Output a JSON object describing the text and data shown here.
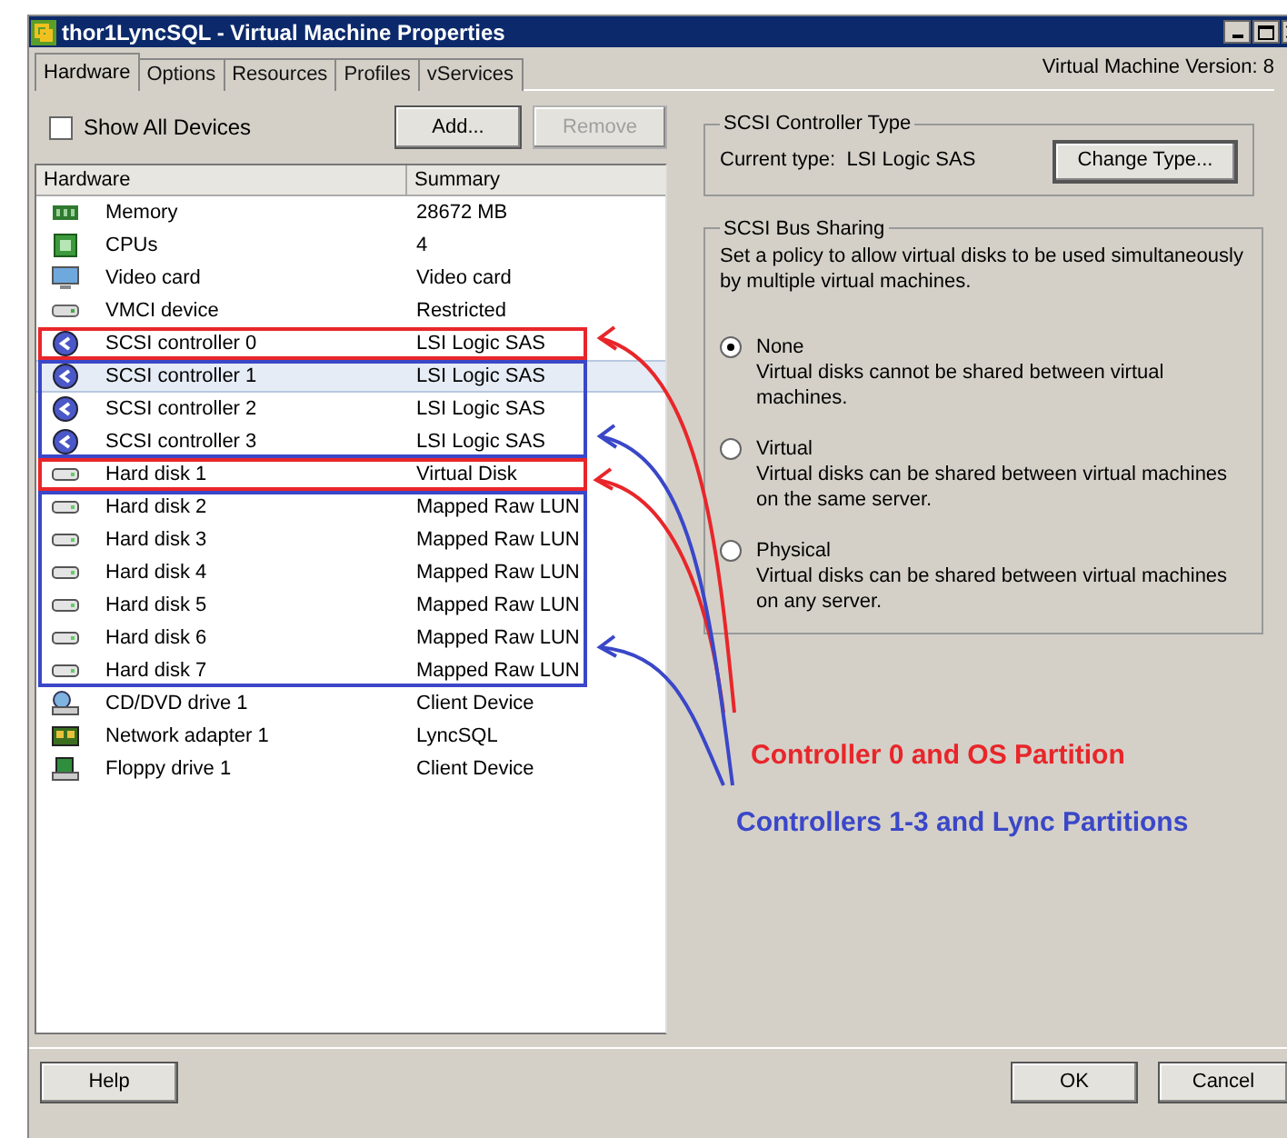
{
  "window": {
    "title": "thor1LyncSQL - Virtual Machine Properties"
  },
  "tabs": [
    {
      "label": "Hardware",
      "selected": true
    },
    {
      "label": "Options",
      "selected": false
    },
    {
      "label": "Resources",
      "selected": false
    },
    {
      "label": "Profiles",
      "selected": false
    },
    {
      "label": "vServices",
      "selected": false
    }
  ],
  "version": "Virtual Machine Version: 8",
  "show_all_devices": {
    "label": "Show All Devices",
    "checked": false
  },
  "add_button": {
    "label": "Add...",
    "disabled": false
  },
  "remove_button": {
    "label": "Remove",
    "disabled": true
  },
  "table": {
    "columns": [
      "Hardware",
      "Summary"
    ],
    "groups": [
      {
        "outlined": false,
        "rows": [
          {
            "kind": "memory",
            "name": "Memory",
            "summary": "28672 MB",
            "selected": false
          },
          {
            "kind": "cpu",
            "name": "CPUs",
            "summary": "4",
            "selected": false
          },
          {
            "kind": "video",
            "name": "Video card",
            "summary": "Video card",
            "selected": false
          },
          {
            "kind": "vmci",
            "name": "VMCI device",
            "summary": "Restricted",
            "selected": false
          }
        ]
      },
      {
        "outlined": true,
        "color": "#e8262a",
        "rows": [
          {
            "kind": "scsi",
            "name": "SCSI controller 0",
            "summary": "LSI Logic SAS",
            "selected": false
          }
        ]
      },
      {
        "outlined": true,
        "color": "#3a47c8",
        "rows": [
          {
            "kind": "scsi",
            "name": "SCSI controller 1",
            "summary": "LSI Logic SAS",
            "selected": true
          },
          {
            "kind": "scsi",
            "name": "SCSI controller 2",
            "summary": "LSI Logic SAS",
            "selected": false
          },
          {
            "kind": "scsi",
            "name": "SCSI controller 3",
            "summary": "LSI Logic SAS",
            "selected": false
          }
        ]
      },
      {
        "outlined": true,
        "color": "#e8262a",
        "rows": [
          {
            "kind": "disk",
            "name": "Hard disk 1",
            "summary": "Virtual Disk",
            "selected": false
          }
        ]
      },
      {
        "outlined": true,
        "color": "#3a47c8",
        "rows": [
          {
            "kind": "disk",
            "name": "Hard disk 2",
            "summary": "Mapped Raw LUN",
            "selected": false
          },
          {
            "kind": "disk",
            "name": "Hard disk 3",
            "summary": "Mapped Raw LUN",
            "selected": false
          },
          {
            "kind": "disk",
            "name": "Hard disk 4",
            "summary": "Mapped Raw LUN",
            "selected": false
          },
          {
            "kind": "disk",
            "name": "Hard disk 5",
            "summary": "Mapped Raw LUN",
            "selected": false
          },
          {
            "kind": "disk",
            "name": "Hard disk 6",
            "summary": "Mapped Raw LUN",
            "selected": false
          },
          {
            "kind": "disk",
            "name": "Hard disk 7",
            "summary": "Mapped Raw LUN",
            "selected": false
          }
        ]
      },
      {
        "outlined": false,
        "rows": [
          {
            "kind": "cdrom",
            "name": "CD/DVD drive 1",
            "summary": "Client Device",
            "selected": false
          },
          {
            "kind": "network",
            "name": "Network adapter 1",
            "summary": "LyncSQL",
            "selected": false
          },
          {
            "kind": "floppy",
            "name": "Floppy drive 1",
            "summary": "Client Device",
            "selected": false
          }
        ]
      }
    ]
  },
  "controller_type": {
    "title": "SCSI Controller Type",
    "label": "Current type:",
    "value": "LSI Logic SAS",
    "button": "Change Type..."
  },
  "bus_sharing": {
    "title": "SCSI Bus Sharing",
    "description": "Set a policy to allow virtual disks to be used simultaneously by multiple virtual machines.",
    "options": [
      {
        "label": "None",
        "description": "Virtual disks cannot be shared between virtual machines.",
        "selected": true
      },
      {
        "label": "Virtual",
        "description": "Virtual disks can be shared between virtual machines on the same server.",
        "selected": false
      },
      {
        "label": "Physical",
        "description": "Virtual disks can be shared between virtual machines on any server.",
        "selected": false
      }
    ]
  },
  "annotations": [
    {
      "text": "Controller 0 and OS Partition",
      "color": "#e8262a"
    },
    {
      "text": "Controllers 1-3 and Lync Partitions",
      "color": "#3a47c8"
    }
  ],
  "buttons": {
    "help": "Help",
    "ok": "OK",
    "cancel": "Cancel"
  }
}
